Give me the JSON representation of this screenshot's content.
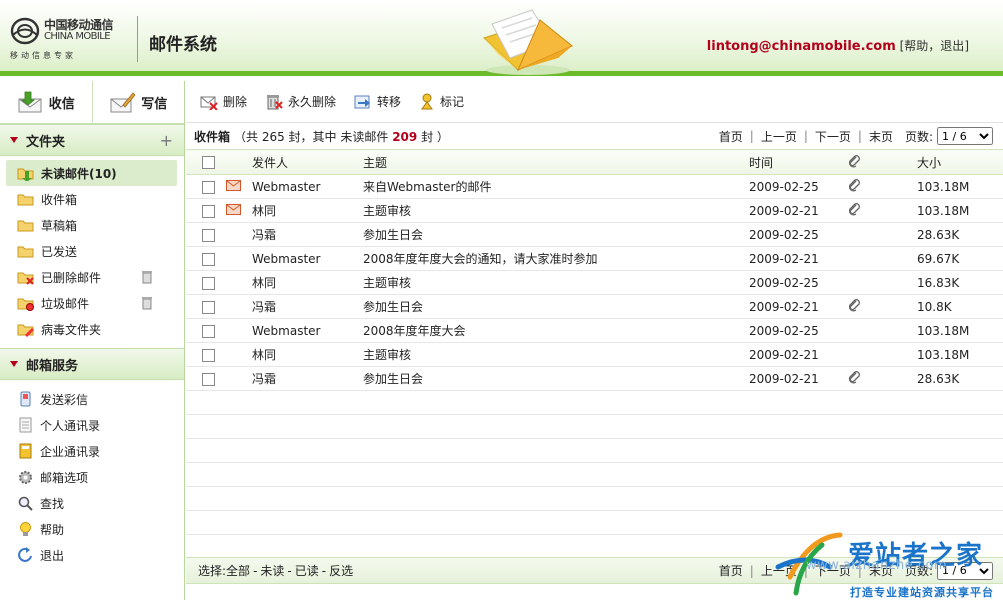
{
  "header": {
    "logo_cn": "中国移动通信",
    "logo_en": "CHINA MOBILE",
    "logo_slogan": "移动信息专家",
    "system_title": "邮件系统",
    "user_email": "lintong@chinamobile.com",
    "help_label": "帮助",
    "logout_label": "退出"
  },
  "sidebar": {
    "inbox_btn": "收信",
    "compose_btn": "写信",
    "folders_title": "文件夹",
    "add_icon": "+",
    "folders": [
      {
        "label": "未读邮件(10)",
        "icon": "folder-arrow-icon"
      },
      {
        "label": "收件箱",
        "icon": "folder-icon"
      },
      {
        "label": "草稿箱",
        "icon": "folder-icon"
      },
      {
        "label": "已发送",
        "icon": "folder-icon"
      },
      {
        "label": "已删除邮件",
        "icon": "folder-deleted-icon"
      },
      {
        "label": "垃圾邮件",
        "icon": "folder-spam-icon"
      },
      {
        "label": "病毒文件夹",
        "icon": "folder-virus-icon"
      }
    ],
    "services_title": "邮箱服务",
    "services": [
      {
        "label": "发送彩信",
        "icon": "mms-phone-icon"
      },
      {
        "label": "个人通讯录",
        "icon": "address-book-icon"
      },
      {
        "label": "企业通讯录",
        "icon": "company-book-icon"
      },
      {
        "label": "邮箱选项",
        "icon": "gear-icon"
      },
      {
        "label": "查找",
        "icon": "search-icon"
      },
      {
        "label": "帮助",
        "icon": "lightbulb-icon"
      },
      {
        "label": "退出",
        "icon": "exit-icon"
      }
    ]
  },
  "toolbar": {
    "delete": "删除",
    "perm_delete": "永久删除",
    "move": "转移",
    "mark": "标记"
  },
  "inbox_info": {
    "title": "收件箱",
    "count_prefix": "（共 265 封，其中 未读邮件",
    "unread": "209",
    "count_suffix": "封 ）"
  },
  "pager": {
    "first": "首页",
    "prev": "上一页",
    "next": "下一页",
    "last": "末页",
    "pages_label": "页数:",
    "current": "1 / 6"
  },
  "table": {
    "headers": {
      "from": "发件人",
      "subject": "主题",
      "time": "时间",
      "size": "大小"
    },
    "rows": [
      {
        "unread": true,
        "from": "Webmaster",
        "subject": "来自Webmaster的邮件",
        "time": "2009-02-25",
        "attach": true,
        "size": "103.18M"
      },
      {
        "unread": true,
        "from": "林同",
        "subject": "主题审核",
        "time": "2009-02-21",
        "attach": true,
        "size": "103.18M"
      },
      {
        "unread": false,
        "from": "冯霜",
        "subject": "参加生日会",
        "time": "2009-02-25",
        "attach": false,
        "size": "28.63K"
      },
      {
        "unread": false,
        "from": "Webmaster",
        "subject": "2008年度年度大会的通知，请大家准时参加",
        "time": "2009-02-21",
        "attach": false,
        "size": "69.67K"
      },
      {
        "unread": false,
        "from": "林同",
        "subject": "主题审核",
        "time": "2009-02-25",
        "attach": false,
        "size": "16.83K"
      },
      {
        "unread": false,
        "from": "冯霜",
        "subject": "参加生日会",
        "time": "2009-02-21",
        "attach": true,
        "size": "10.8K"
      },
      {
        "unread": false,
        "from": "Webmaster",
        "subject": "2008年度年度大会",
        "time": "2009-02-25",
        "attach": false,
        "size": "103.18M"
      },
      {
        "unread": false,
        "from": "林同",
        "subject": "主题审核",
        "time": "2009-02-21",
        "attach": false,
        "size": "103.18M"
      },
      {
        "unread": false,
        "from": "冯霜",
        "subject": "参加生日会",
        "time": "2009-02-21",
        "attach": true,
        "size": "28.63K"
      }
    ],
    "empty_rows": 6
  },
  "footer": {
    "select_label": "选择:",
    "all": "全部",
    "unread": "未读",
    "read": "已读",
    "invert": "反选"
  },
  "watermark": {
    "title": "爱站者之家",
    "url": "www.aizhanzhe.com",
    "subtitle": "打造专业建站资源共享平台"
  },
  "colors": {
    "accent_green": "#6dbb2a",
    "unread_red": "#b3001b",
    "watermark_blue": "#1a74c9"
  }
}
